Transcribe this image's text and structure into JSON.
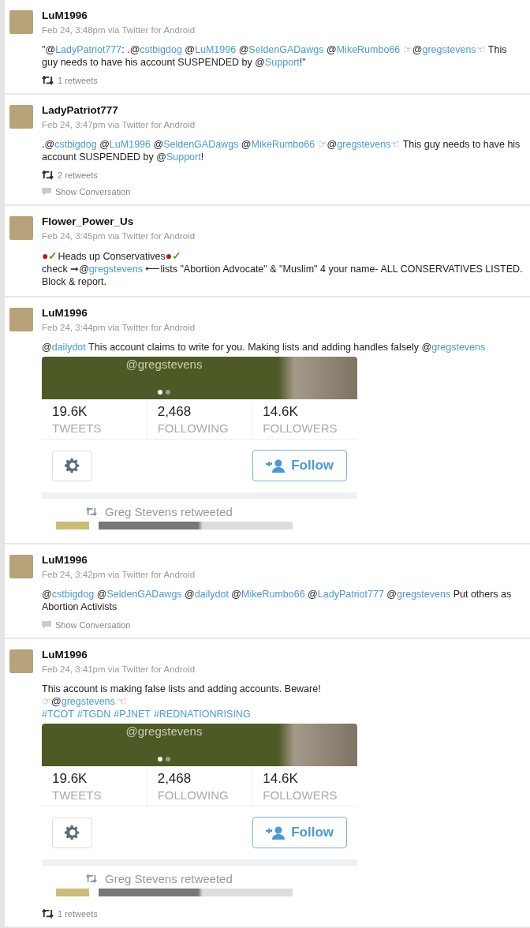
{
  "tweets": [
    {
      "user": "LuM1996",
      "meta": "Feb 24, 3:48pm via Twitter for Android",
      "text": [
        {
          "kind": "text",
          "text": "\"@"
        },
        {
          "kind": "link",
          "text": "LadyPatriot777"
        },
        {
          "kind": "text",
          "text": ": .@"
        },
        {
          "kind": "link",
          "text": "cstbigdog"
        },
        {
          "kind": "text",
          "text": " @"
        },
        {
          "kind": "link",
          "text": "LuM1996"
        },
        {
          "kind": "text",
          "text": " @"
        },
        {
          "kind": "link",
          "text": "SeldenGADawgs"
        },
        {
          "kind": "text",
          "text": " @"
        },
        {
          "kind": "link",
          "text": "MikeRumbo66"
        },
        {
          "kind": "hand",
          "text": " ☞"
        },
        {
          "kind": "text",
          "text": "@"
        },
        {
          "kind": "link",
          "text": "gregstevens"
        },
        {
          "kind": "hand",
          "text": "☜"
        },
        {
          "kind": "text",
          "text": " This guy needs to have his account SUSPENDED by @"
        },
        {
          "kind": "link",
          "text": "Support"
        },
        {
          "kind": "text",
          "text": "!\""
        }
      ],
      "retweets": "1 retweets"
    },
    {
      "user": "LadyPatriot777",
      "meta": "Feb 24, 3:47pm via Twitter for Android",
      "text": [
        {
          "kind": "text",
          "text": ".@"
        },
        {
          "kind": "link",
          "text": "cstbigdog"
        },
        {
          "kind": "text",
          "text": " @"
        },
        {
          "kind": "link",
          "text": "LuM1996"
        },
        {
          "kind": "text",
          "text": " @"
        },
        {
          "kind": "link",
          "text": "SeldenGADawgs"
        },
        {
          "kind": "text",
          "text": " @"
        },
        {
          "kind": "link",
          "text": "MikeRumbo66"
        },
        {
          "kind": "hand",
          "text": " ☞"
        },
        {
          "kind": "text",
          "text": "@"
        },
        {
          "kind": "link",
          "text": "gregstevens"
        },
        {
          "kind": "hand",
          "text": "☜"
        },
        {
          "kind": "text",
          "text": " This guy needs to have his account SUSPENDED by @"
        },
        {
          "kind": "link",
          "text": "Support"
        },
        {
          "kind": "text",
          "text": "!"
        }
      ],
      "retweets": "2 retweets",
      "conversation": "Show Conversation"
    },
    {
      "user": "Flower_Power_Us",
      "meta": "Feb 24, 3:45pm via Twitter for Android",
      "text": [
        {
          "kind": "symbol",
          "text": "●",
          "color": "#c0141c"
        },
        {
          "kind": "symbol",
          "text": "✓",
          "color": "#3fae2a"
        },
        {
          "kind": "text",
          "text": "Heads up Conservatives"
        },
        {
          "kind": "symbol",
          "text": "●",
          "color": "#c0141c"
        },
        {
          "kind": "symbol",
          "text": "✓",
          "color": "#3fae2a"
        },
        {
          "kind": "text",
          "text": "\ncheck ➞@"
        },
        {
          "kind": "link",
          "text": "gregstevens"
        },
        {
          "kind": "text",
          "text": " ⟵lists \"Abortion Advocate\" & \"Muslim\" 4 your name- ALL CONSERVATIVES LISTED. Block & report."
        }
      ]
    },
    {
      "user": "LuM1996",
      "meta": "Feb 24, 3:44pm via Twitter for Android",
      "text": [
        {
          "kind": "text",
          "text": "@"
        },
        {
          "kind": "link",
          "text": "dailydot"
        },
        {
          "kind": "text",
          "text": " This account claims to write for you. Making lists and adding handles falsely @"
        },
        {
          "kind": "link",
          "text": "gregstevens"
        }
      ],
      "media": {
        "caption": "@gregstevens",
        "dots": [
          {
            "selected": true
          },
          {
            "selected": false
          }
        ],
        "stats": [
          {
            "value": "19.6K",
            "label": "TWEETS"
          },
          {
            "value": "2,468",
            "label": "FOLLOWING"
          },
          {
            "value": "14.6K",
            "label": "FOLLOWERS"
          }
        ],
        "follow": "Follow",
        "retweeted": "Greg Stevens retweeted"
      }
    },
    {
      "user": "LuM1996",
      "meta": "Feb 24, 3:42pm via Twitter for Android",
      "text": [
        {
          "kind": "text",
          "text": "@"
        },
        {
          "kind": "link",
          "text": "cstbigdog"
        },
        {
          "kind": "text",
          "text": " @"
        },
        {
          "kind": "link",
          "text": "SeldenGADawgs"
        },
        {
          "kind": "text",
          "text": " @"
        },
        {
          "kind": "link",
          "text": "dailydot"
        },
        {
          "kind": "text",
          "text": " @"
        },
        {
          "kind": "link",
          "text": "MikeRumbo66"
        },
        {
          "kind": "text",
          "text": " @"
        },
        {
          "kind": "link",
          "text": "LadyPatriot777"
        },
        {
          "kind": "text",
          "text": " @"
        },
        {
          "kind": "link",
          "text": "gregstevens"
        },
        {
          "kind": "text",
          "text": " Put others as Abortion Activists"
        }
      ],
      "conversation": "Show Conversation"
    },
    {
      "user": "LuM1996",
      "meta": "Feb 24, 3:41pm via Twitter for Android",
      "text": [
        {
          "kind": "text",
          "text": "This account is making false lists and adding accounts. Beware!\n"
        },
        {
          "kind": "hand",
          "text": "☞"
        },
        {
          "kind": "text",
          "text": "@"
        },
        {
          "kind": "link",
          "text": "gregstevens"
        },
        {
          "kind": "hand",
          "text": " ☜"
        }
      ],
      "hashtags": [
        "#TCOT",
        "#TGDN",
        "#PJNET",
        "#REDNATIONRISING"
      ],
      "media": {
        "caption": "@gregstevens",
        "dots": [
          {
            "selected": true
          },
          {
            "selected": false
          }
        ],
        "stats": [
          {
            "value": "19.6K",
            "label": "TWEETS"
          },
          {
            "value": "2,468",
            "label": "FOLLOWING"
          },
          {
            "value": "14.6K",
            "label": "FOLLOWERS"
          }
        ],
        "follow": "Follow",
        "retweeted": "Greg Stevens retweeted"
      },
      "retweets": "1 retweets"
    }
  ]
}
